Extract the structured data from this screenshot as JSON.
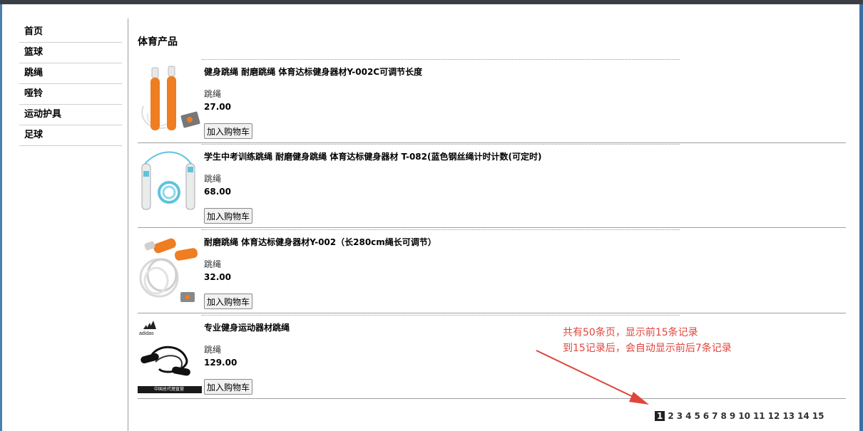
{
  "sidebar": {
    "items": [
      {
        "label": "首页"
      },
      {
        "label": "篮球"
      },
      {
        "label": "跳绳"
      },
      {
        "label": "哑铃"
      },
      {
        "label": "运动护具"
      },
      {
        "label": "足球"
      }
    ]
  },
  "main": {
    "section_title": "体育产品",
    "products": [
      {
        "name": "健身跳绳 耐磨跳绳 体育达标健身器材Y-002C可调节长度",
        "category": "跳绳",
        "price": "27.00",
        "button": "加入购物车",
        "image_icon": "orange-jump-rope-image"
      },
      {
        "name": "学生中考训练跳绳 耐磨健身跳绳 体育达标健身器材 T-082(蓝色钢丝绳计时计数(可定时)",
        "category": "跳绳",
        "price": "68.00",
        "button": "加入购物车",
        "image_icon": "blue-jump-rope-image"
      },
      {
        "name": "耐磨跳绳 体育达标健身器材Y-002（长280cm绳长可调节）",
        "category": "跳绳",
        "price": "32.00",
        "button": "加入购物车",
        "image_icon": "orange-rope-coil-image"
      },
      {
        "name": "专业健身运动器材跳绳",
        "category": "跳绳",
        "price": "129.00",
        "button": "加入购物车",
        "image_icon": "adidas-jump-rope-image",
        "image_text": "中国总代理直营"
      }
    ]
  },
  "annotation": {
    "line1": "共有50条页，显示前15条记录",
    "line2": "到15记录后，会自动显示前后7条记录"
  },
  "pagination": {
    "pages": [
      "1",
      "2",
      "3",
      "4",
      "5",
      "6",
      "7",
      "8",
      "9",
      "10",
      "11",
      "12",
      "13",
      "14",
      "15"
    ],
    "current": "1"
  },
  "colors": {
    "annotation": "#e0453c",
    "rope_orange": "#ef7d22",
    "rope_blue": "#5fc3dc"
  }
}
